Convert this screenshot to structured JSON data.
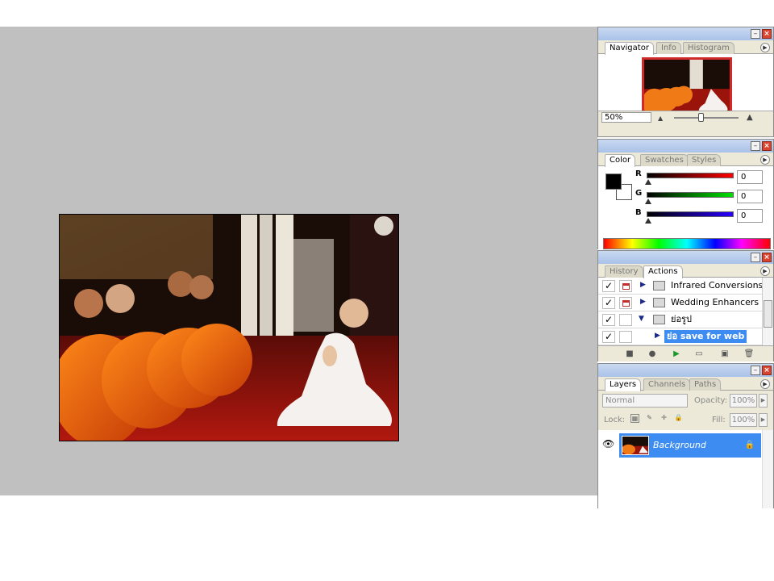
{
  "navigator_panel": {
    "tabs": [
      "Navigator",
      "Info",
      "Histogram"
    ],
    "zoom": "50%"
  },
  "color_panel": {
    "tabs": [
      "Color",
      "Swatches",
      "Styles"
    ],
    "foreground_color": "#000000",
    "background_color": "#ffffff",
    "channels": [
      {
        "label": "R",
        "value": "0"
      },
      {
        "label": "G",
        "value": "0"
      },
      {
        "label": "B",
        "value": "0"
      }
    ]
  },
  "actions_panel": {
    "tabs": [
      "History",
      "Actions"
    ],
    "items": [
      {
        "label": "Infrared Conversions",
        "checked": true,
        "expanded": false,
        "selected": false
      },
      {
        "label": "Wedding Enhancers",
        "checked": true,
        "expanded": false,
        "selected": false
      },
      {
        "label": "ย่อรูป",
        "checked": true,
        "expanded": true,
        "selected": false
      },
      {
        "label": "ย่อ save for web",
        "checked": true,
        "expanded": false,
        "selected": true
      }
    ]
  },
  "layers_panel": {
    "tabs": [
      "Layers",
      "Channels",
      "Paths"
    ],
    "blend_mode": "Normal",
    "opacity_label": "Opacity:",
    "opacity": "100%",
    "lock_label": "Lock:",
    "fill_label": "Fill:",
    "fill": "100%",
    "layers": [
      {
        "name": "Background",
        "visible": true,
        "locked": true
      }
    ]
  },
  "colors": {
    "workspace": "#c0c0c0",
    "selection": "#3d8cf2",
    "navigator_view_box": "#d12a2a"
  }
}
